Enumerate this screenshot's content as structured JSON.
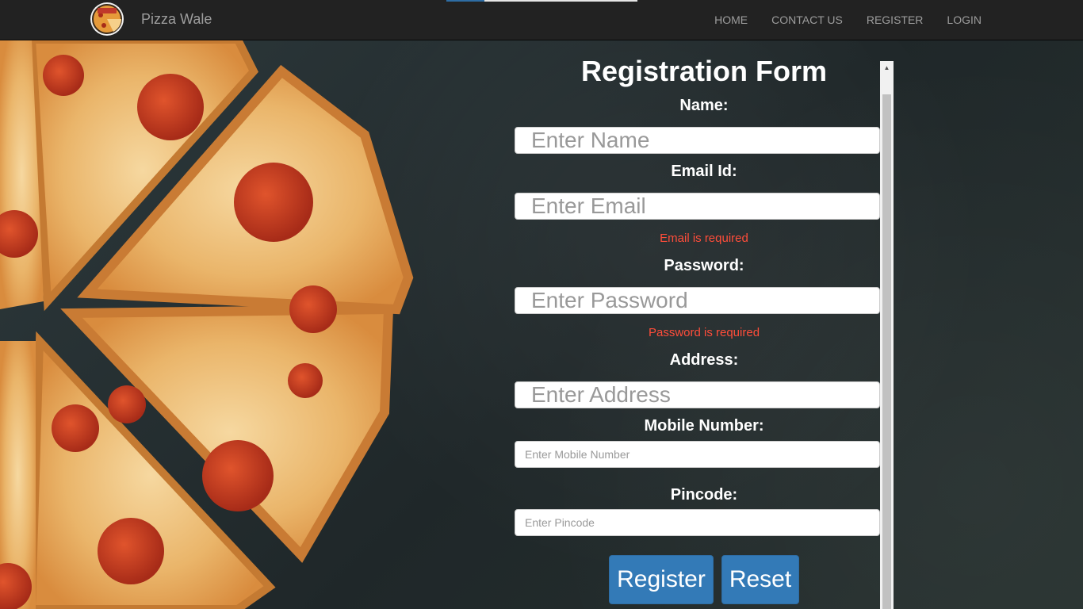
{
  "navbar": {
    "brand": "Pizza Wale",
    "logo_text": "Pizza Wale",
    "progress": 0.2,
    "links": [
      "HOME",
      "CONTACT US",
      "REGISTER",
      "LOGIN"
    ]
  },
  "form": {
    "title": "Registration Form",
    "name_label": "Name:",
    "name_placeholder": "Enter Name",
    "email_label": "Email Id:",
    "email_placeholder": "Enter Email",
    "email_error": "Email is required",
    "password_label": "Password:",
    "password_placeholder": "Enter Password",
    "password_error": "Password is required",
    "address_label": "Address:",
    "address_placeholder": "Enter Address",
    "mobile_label": "Mobile Number:",
    "mobile_placeholder": "Enter Mobile Number",
    "pincode_label": "Pincode:",
    "pincode_placeholder": "Enter Pincode",
    "register_label": "Register",
    "reset_label": "Reset"
  },
  "colors": {
    "navbar": "#222222",
    "primary_button": "#337ab7",
    "error_text": "#ff4d3a"
  }
}
